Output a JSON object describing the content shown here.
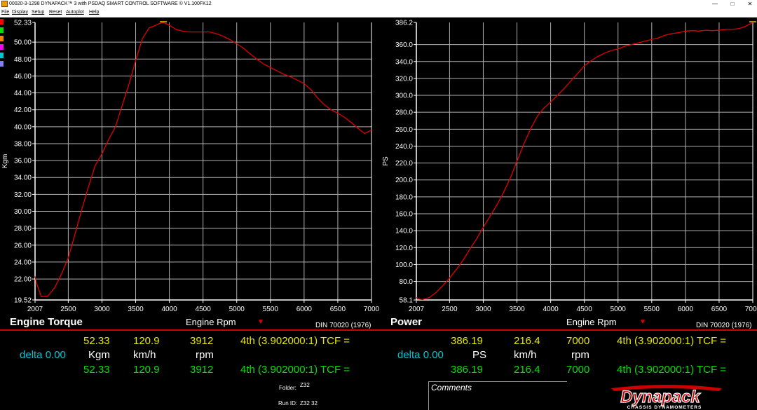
{
  "window": {
    "title": "00020-3-1298 DYNAPACK™ 3 with PSDAQ SMART CONTROL SOFTWARE © V1.100FK12",
    "minimize": "—",
    "maximize": "□",
    "close": "✕"
  },
  "menu": [
    {
      "label": "File"
    },
    {
      "label": "Display"
    },
    {
      "label": "Setup"
    },
    {
      "label": "Reset"
    },
    {
      "label": "Autoplot"
    },
    {
      "label": "Help"
    }
  ],
  "swatch_colors": [
    "#ff0000",
    "#00e000",
    "#ff8000",
    "#ff00ff",
    "#00c8d0",
    "#8080ff"
  ],
  "chart_data": [
    {
      "type": "line",
      "title": "Engine Torque",
      "xlabel": "Engine Rpm",
      "ylabel": "Kgm",
      "standard": "DIN 70020 (1976)",
      "xlim": [
        2007,
        7000
      ],
      "ylim": [
        19.52,
        52.33
      ],
      "x_ticks": [
        "2007",
        "2500",
        "3000",
        "3500",
        "4000",
        "4500",
        "5000",
        "5500",
        "6000",
        "6500",
        "7000"
      ],
      "y_ticks": [
        "52.33",
        "50.00",
        "48.00",
        "46.00",
        "44.00",
        "42.00",
        "40.00",
        "38.00",
        "36.00",
        "34.00",
        "32.00",
        "30.00",
        "28.00",
        "26.00",
        "24.00",
        "22.00",
        "19.52"
      ],
      "grid": true,
      "series": [
        {
          "color": "#e00000",
          "x": [
            2007,
            2030,
            2100,
            2200,
            2300,
            2400,
            2500,
            2600,
            2700,
            2800,
            2900,
            3000,
            3100,
            3200,
            3300,
            3400,
            3500,
            3600,
            3700,
            3800,
            3850,
            3912,
            4000,
            4100,
            4200,
            4300,
            4400,
            4500,
            4600,
            4700,
            4800,
            4900,
            5000,
            5100,
            5200,
            5300,
            5400,
            5500,
            5600,
            5700,
            5800,
            5900,
            6000,
            6100,
            6200,
            6300,
            6400,
            6500,
            6600,
            6700,
            6800,
            6900,
            7000
          ],
          "values": [
            22.3,
            21.5,
            19.9,
            20.0,
            21.0,
            22.6,
            24.5,
            27.3,
            30.2,
            32.9,
            35.4,
            36.8,
            38.5,
            40.0,
            42.5,
            45.0,
            47.8,
            50.4,
            51.7,
            52.0,
            52.2,
            52.33,
            52.0,
            51.5,
            51.3,
            51.2,
            51.2,
            51.2,
            51.2,
            51.0,
            50.7,
            50.3,
            49.8,
            49.3,
            48.6,
            48.0,
            47.4,
            47.0,
            46.6,
            46.2,
            45.9,
            45.5,
            45.1,
            44.4,
            43.4,
            42.6,
            42.0,
            41.6,
            41.1,
            40.5,
            39.8,
            39.2,
            39.6
          ]
        }
      ]
    },
    {
      "type": "line",
      "title": "Power",
      "xlabel": "Engine Rpm",
      "ylabel": "PS",
      "standard": "DIN 70020 (1976)",
      "xlim": [
        2007,
        7000
      ],
      "ylim": [
        58.1,
        386.2
      ],
      "x_ticks": [
        "2007",
        "2500",
        "3000",
        "3500",
        "4000",
        "4500",
        "5000",
        "5500",
        "6000",
        "6500",
        "7000"
      ],
      "y_ticks": [
        "386.2",
        "360.0",
        "340.0",
        "320.0",
        "300.0",
        "280.0",
        "260.0",
        "240.0",
        "220.0",
        "200.0",
        "180.0",
        "160.0",
        "140.0",
        "120.0",
        "100.0",
        "80.0",
        "58.1"
      ],
      "grid": true,
      "series": [
        {
          "color": "#e00000",
          "x": [
            2007,
            2050,
            2100,
            2200,
            2300,
            2400,
            2500,
            2600,
            2700,
            2800,
            2900,
            3000,
            3100,
            3200,
            3300,
            3400,
            3500,
            3600,
            3700,
            3800,
            3900,
            4000,
            4100,
            4200,
            4300,
            4400,
            4500,
            4600,
            4700,
            4800,
            4900,
            5000,
            5100,
            5200,
            5300,
            5400,
            5500,
            5600,
            5700,
            5800,
            5900,
            6000,
            6100,
            6200,
            6300,
            6400,
            6500,
            6600,
            6700,
            6800,
            6900,
            7000
          ],
          "values": [
            61,
            59,
            58.5,
            61,
            67,
            75,
            84,
            94,
            105,
            118,
            130,
            144,
            157,
            170,
            185,
            202,
            222,
            242,
            260,
            275,
            285,
            292,
            300,
            308,
            317,
            326,
            335,
            341,
            346,
            350,
            353,
            355,
            358,
            360,
            362,
            364,
            366,
            368,
            371,
            373,
            374,
            376,
            376.5,
            376,
            377,
            376.5,
            377,
            378,
            378,
            379,
            382,
            386.19
          ]
        }
      ]
    }
  ],
  "readout": {
    "torque": {
      "row1": {
        "value": "52.33",
        "speed": "120.9",
        "rpm": "3912",
        "gear": "4th (3.902000:1) TCF ="
      },
      "row2": {
        "delta": "delta 0.00",
        "unit": "Kgm",
        "speed_unit": "km/h",
        "rpm_unit": "rpm"
      },
      "row3": {
        "value": "52.33",
        "speed": "120.9",
        "rpm": "3912",
        "gear": "4th (3.902000:1) TCF ="
      }
    },
    "power": {
      "row1": {
        "value": "386.19",
        "speed": "216.4",
        "rpm": "7000",
        "gear": "4th (3.902000:1) TCF ="
      },
      "row2": {
        "delta": "delta 0.00",
        "unit": "PS",
        "speed_unit": "km/h",
        "rpm_unit": "rpm"
      },
      "row3": {
        "value": "386.19",
        "speed": "216.4",
        "rpm": "7000",
        "gear": "4th (3.902000:1) TCF ="
      }
    }
  },
  "folder": {
    "label": "Folder:",
    "value": "Z32"
  },
  "run_id": {
    "label": "Run ID:",
    "value": "Z32 32"
  },
  "comments": {
    "label": "Comments"
  },
  "logo": {
    "brand": "Dynapack",
    "tagline": "CHASSIS DYNAMOMETERS"
  }
}
